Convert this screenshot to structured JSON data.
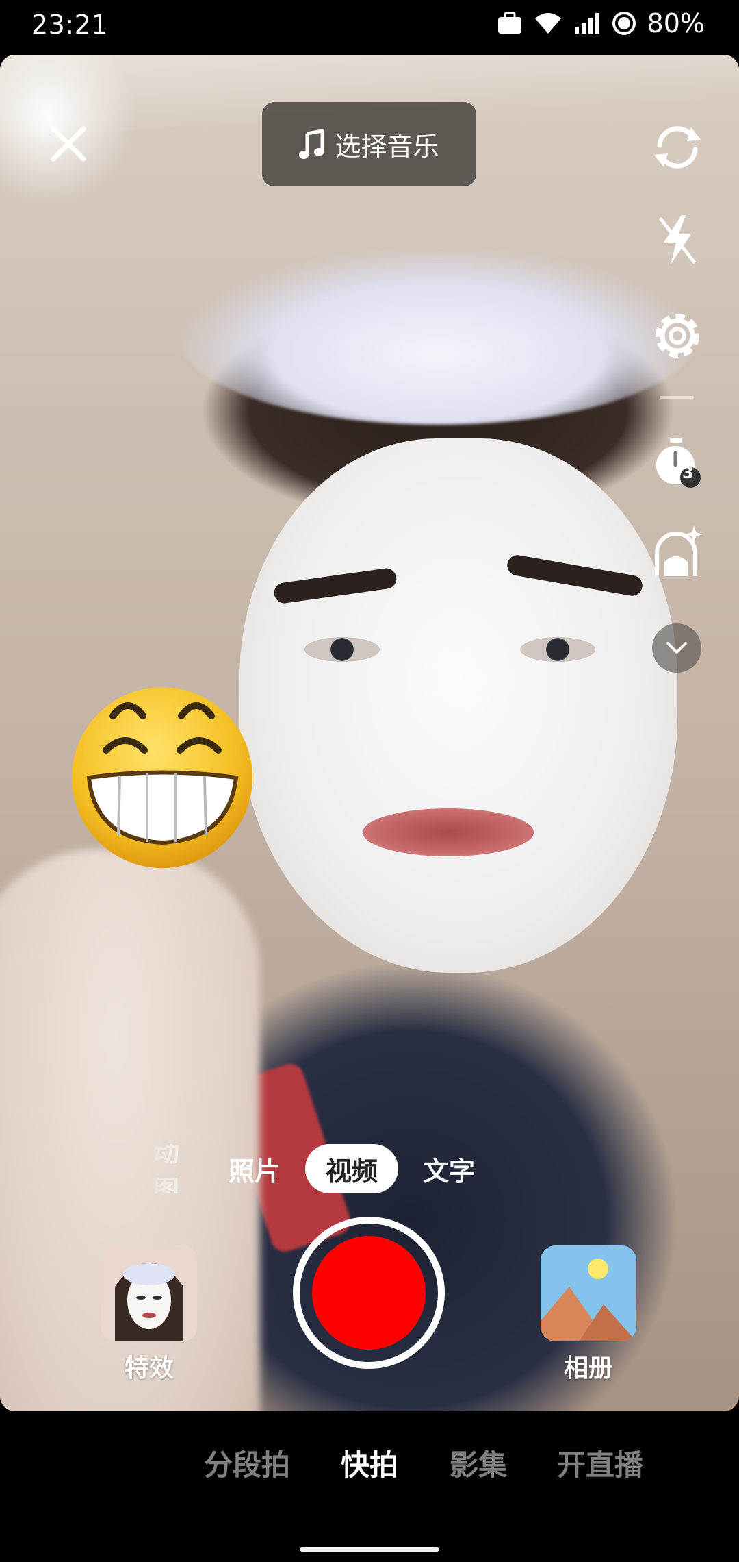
{
  "status_bar": {
    "time": "23:21",
    "battery": "80%"
  },
  "top_bar": {
    "close_icon": "close-icon",
    "music_label": "选择音乐"
  },
  "side_tools": [
    "flip-camera-icon",
    "flash-off-icon",
    "settings-icon",
    "timer-icon",
    "beauty-icon",
    "expand-icon"
  ],
  "timer_value": "3",
  "mode_tabs": {
    "partial": "动图",
    "photo": "照片",
    "video": "视频",
    "text": "文字"
  },
  "capture_row": {
    "effects_label": "特效",
    "album_label": "相册"
  },
  "bottom_nav": {
    "segment": "分段拍",
    "quick": "快拍",
    "album": "影集",
    "live": "开直播"
  },
  "colors": {
    "shutter": "#fe0000",
    "active_tab_bg": "#ffffff"
  }
}
